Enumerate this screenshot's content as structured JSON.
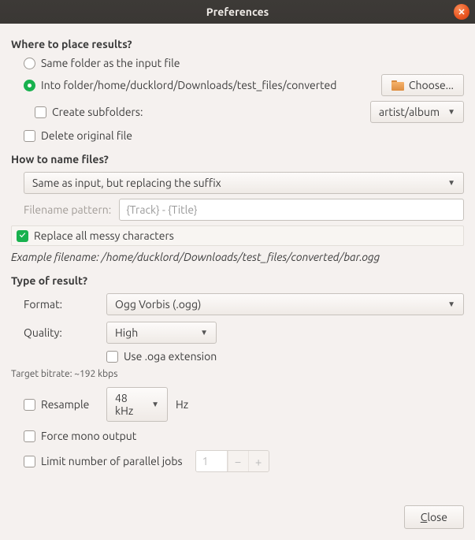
{
  "window": {
    "title": "Preferences"
  },
  "place": {
    "heading": "Where to place results?",
    "same_folder": "Same folder as the input file",
    "into_folder_prefix": "Into folder ",
    "into_folder_path": "/home/ducklord/Downloads/test_files/converted",
    "choose": "Choose...",
    "create_subfolders": "Create subfolders:",
    "subfolder_pattern": "artist/album",
    "delete_original": "Delete original file"
  },
  "naming": {
    "heading": "How to name files?",
    "mode": "Same as input, but replacing the suffix",
    "pattern_label": "Filename pattern:",
    "pattern_placeholder": "{Track} - {Title}",
    "replace_messy": "Replace all messy characters",
    "example_label": "Example filename: ",
    "example_path": "/home/ducklord/Downloads/test_files/converted/bar.ogg"
  },
  "result": {
    "heading": "Type of result?",
    "format_label": "Format:",
    "format_value": "Ogg Vorbis (.ogg)",
    "quality_label": "Quality:",
    "quality_value": "High",
    "use_oga": "Use .oga extension",
    "target_bitrate": "Target bitrate: ~192 kbps",
    "resample": "Resample",
    "resample_rate": "48 kHz",
    "hz": "Hz",
    "force_mono": "Force mono output",
    "limit_jobs": "Limit number of parallel jobs",
    "jobs_value": "1"
  },
  "footer": {
    "close": "Close"
  }
}
